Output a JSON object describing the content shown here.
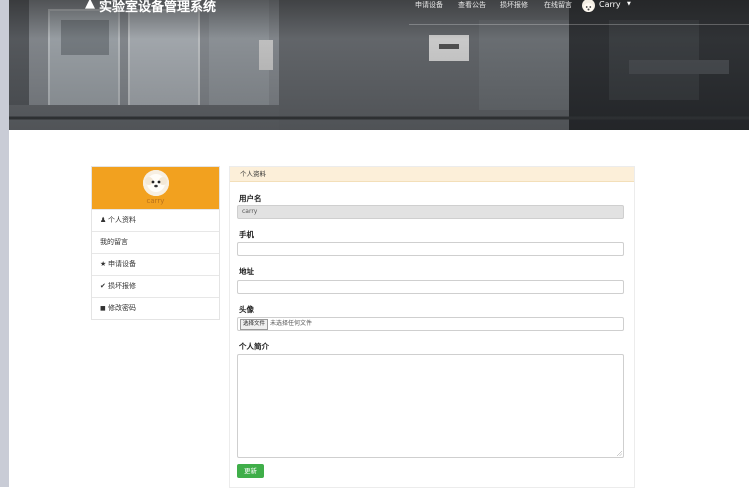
{
  "nav": {
    "brand": "实验室设备管理系统",
    "links": [
      "申请设备",
      "查看公告",
      "损坏报修",
      "在线留言"
    ],
    "user": "Carry"
  },
  "sidebar": {
    "username": "carry",
    "items": [
      {
        "icon": "user-icon",
        "glyph": "♟",
        "label": "个人资料"
      },
      {
        "icon": "none",
        "glyph": "",
        "label": "我的留言"
      },
      {
        "icon": "star-icon",
        "glyph": "★",
        "label": "申请设备"
      },
      {
        "icon": "check-icon",
        "glyph": "✔",
        "label": "损坏报修"
      },
      {
        "icon": "lock-icon",
        "glyph": "🔒",
        "label": "修改密码"
      }
    ]
  },
  "form": {
    "panel_title": "个人资料",
    "username_label": "用户名",
    "username_value": "carry",
    "phone_label": "手机",
    "phone_value": "",
    "address_label": "地址",
    "address_value": "",
    "avatar_label": "头像",
    "file_button": "选择文件",
    "file_status": "未选择任何文件",
    "bio_label": "个人简介",
    "bio_value": "",
    "save_label": "更新"
  },
  "colors": {
    "accent_orange": "#f2a11f",
    "panel_header": "#fcefd9",
    "save_green": "#3fae49"
  }
}
